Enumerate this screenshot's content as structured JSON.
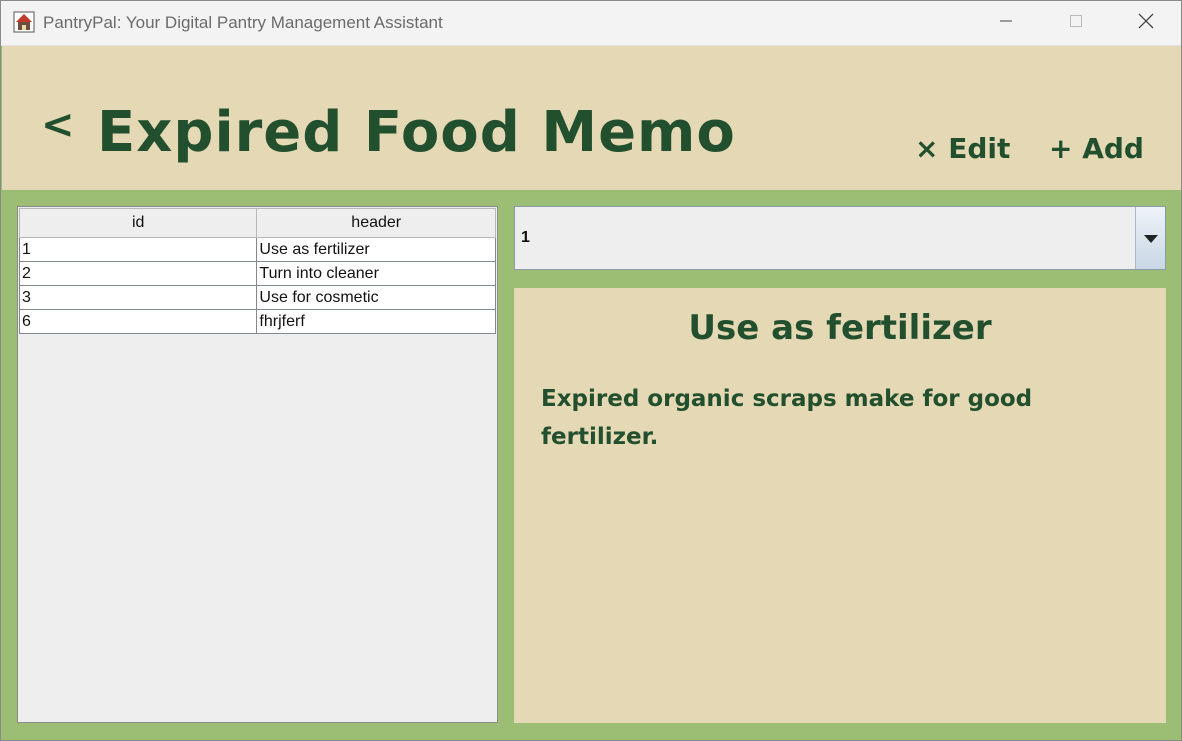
{
  "window": {
    "title": "PantryPal: Your Digital Pantry Management Assistant"
  },
  "header": {
    "back_label": "<",
    "title": "Expired Food Memo",
    "edit_label": "× Edit",
    "add_label": "+ Add"
  },
  "table": {
    "columns": [
      "id",
      "header"
    ],
    "rows": [
      {
        "id": "1",
        "header": "Use as fertilizer"
      },
      {
        "id": "2",
        "header": "Turn into cleaner"
      },
      {
        "id": "3",
        "header": "Use for cosmetic"
      },
      {
        "id": "6",
        "header": "fhrjferf"
      }
    ]
  },
  "selector": {
    "selected_value": "1"
  },
  "detail": {
    "title": "Use as fertilizer",
    "body": "Expired organic scraps make for good fertilizer."
  },
  "colors": {
    "accent_green": "#22502e",
    "panel_tan": "#e5d8b4",
    "background_green": "#9cbd74"
  },
  "icons": {
    "app": "app-icon",
    "minimize": "minimize-icon",
    "maximize": "maximize-icon",
    "close": "close-icon",
    "dropdown": "chevron-down-icon"
  }
}
